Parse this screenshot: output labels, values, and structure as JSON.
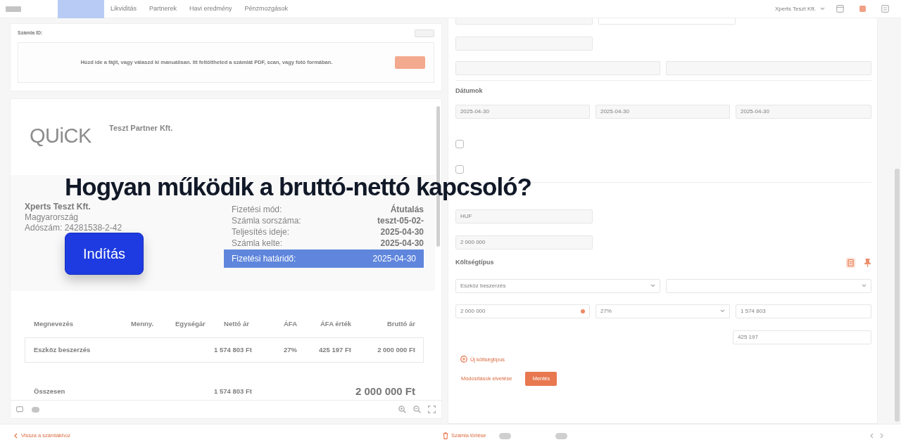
{
  "topbar": {
    "tabs": [
      {
        "selected": true
      },
      {
        "label": "Likviditás",
        "selected": false
      },
      {
        "label": "Partnerek",
        "selected": false
      },
      {
        "label": "Havi eredmény",
        "selected": false
      },
      {
        "label": "Pénzmozgások",
        "selected": false
      }
    ],
    "company": "Xperts Teszt Kft."
  },
  "upload": {
    "invoice_id_label": "Számla ID:",
    "hint": "Húzd ide a fájlt, vagy válaszd ki manuálisan. Itt feltöltheted a számlát PDF, scan, vagy fotó formában."
  },
  "invoice_preview": {
    "logo": "QUiCK",
    "partner": "Teszt Partner Kft.",
    "seller": {
      "name": "Xperts Teszt Kft.",
      "country": "Magyarország",
      "tax_number": "Adószám: 24281538-2-42"
    },
    "details": [
      {
        "label": "Fizetési mód:",
        "value": "Átutalás",
        "highlighted": false
      },
      {
        "label": "Számla sorszáma:",
        "value": "teszt-05-02-",
        "highlighted": false
      },
      {
        "label": "Teljesítés ideje:",
        "value": "2025-04-30",
        "highlighted": false
      },
      {
        "label": "Számla kelte:",
        "value": "2025-04-30",
        "highlighted": false
      },
      {
        "label": "Fizetési határidő:",
        "value": "2025-04-30",
        "highlighted": true
      }
    ],
    "table": {
      "columns": [
        "Megnevezés",
        "Menny.",
        "Egységár",
        "Nettó ár",
        "ÁFA",
        "ÁFA érték",
        "Bruttó ár"
      ],
      "rows": [
        {
          "name": "Eszköz beszerzés",
          "net": "1 574 803 Ft",
          "vat_rate": "27%",
          "vat": "425 197 Ft",
          "gross": "2 000 000 Ft"
        }
      ],
      "total": {
        "label": "Összesen",
        "net": "1 574 803 Ft",
        "gross": "2 000 000 Ft"
      }
    }
  },
  "form": {
    "dates": {
      "title": "Dátumok",
      "values": [
        "2025-04-30",
        "2025-04-30",
        "2025-04-30"
      ]
    },
    "checkboxes": [
      {
        "checked": false
      },
      {
        "checked": false
      }
    ],
    "currency": "HUF",
    "amount": "2 000 000",
    "cost_type": {
      "title": "Költségtípus",
      "category": "Eszköz beszerzés",
      "gross": "2 000 000",
      "vat_rate": "27%",
      "net": "1 574 803",
      "vat": "425 197",
      "add_label": "Új költségtípus"
    },
    "actions": {
      "discard": "Módosítások elvetése",
      "save": "Mentés"
    }
  },
  "bottom_bar": {
    "back": "Vissza a számlákhoz",
    "delete": "Számla törlése",
    "toggles": [
      {
        "on": false
      },
      {
        "on": false
      }
    ]
  },
  "tour": {
    "title": "Hogyan működik a bruttó-nettó kapcsoló?",
    "button": "Indítás"
  }
}
